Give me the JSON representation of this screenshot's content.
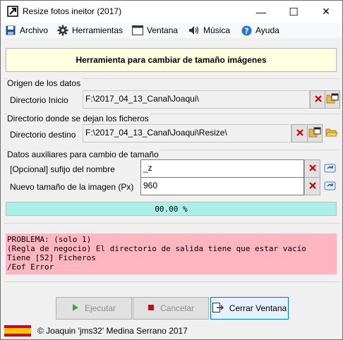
{
  "window": {
    "title": "Resize fotos ineitor (2017)",
    "minimize": "—",
    "maximize": "☐",
    "close": "✕"
  },
  "menu": {
    "archivo": "Archivo",
    "herramientas": "Herramientas",
    "ventana": "Ventana",
    "musica": "Música",
    "ayuda": "Ayuda"
  },
  "header": {
    "title": "Herramienta para cambiar de tamaño imágenes"
  },
  "origen": {
    "group": "Origen de los datos",
    "label": "Directorio Inicio",
    "value": "F:\\2017_04_13_Canal\\Joaqui\\"
  },
  "destino": {
    "group": "Directorio donde se dejan los ficheros",
    "label": "Directorio destino",
    "value": "F:\\2017_04_13_Canal\\Joaqui\\Resize\\"
  },
  "auxiliares": {
    "group": "Datos auxiliares para cambio de tamaño",
    "sufijo_label": "[Opcional] sufijo del nombre",
    "sufijo_value": "_z",
    "tamano_label": "Nuevo tamaño de la imagen (Px)",
    "tamano_value": "960"
  },
  "progress": {
    "text": "00.00 %",
    "fraction": 0
  },
  "error": {
    "lines": [
      "PROBLEMA: (solo 1)",
      "(Regla de negocio) El directorio de salida tiene que estar vacío",
      "Tiene [52] Ficheros",
      "/Eof Error"
    ]
  },
  "buttons": {
    "ejecutar": "Ejecutar",
    "cancelar": "Cancelar",
    "cerrar": "Cerrar Ventana"
  },
  "status": {
    "copyright": "© Joaquin 'jms32' Medina Serrano 2017"
  },
  "colors": {
    "progress_bg": "#a8f0e8",
    "error_bg": "#ffb6c1",
    "header_bg": "#ffffe1",
    "clear_red": "#d40000",
    "folder": "#e8b84a"
  }
}
